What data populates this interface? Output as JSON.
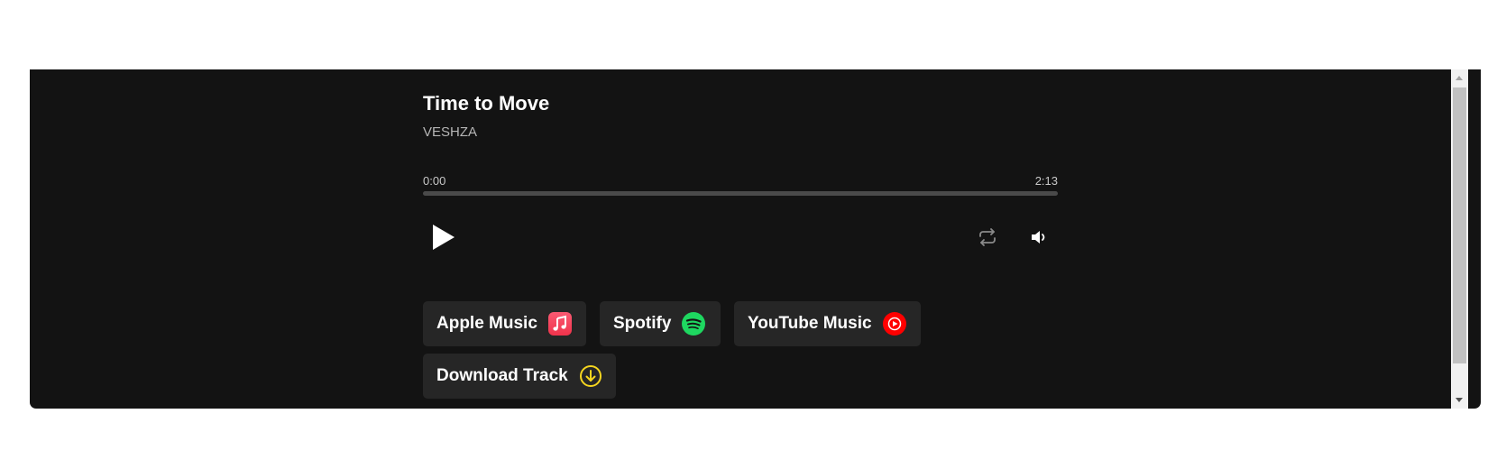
{
  "track": {
    "title": "Time to Move",
    "artist": "VESHZA"
  },
  "playback": {
    "current_time": "0:00",
    "total_time": "2:13",
    "progress_fraction": 0
  },
  "controls": {
    "play_icon": "play-icon",
    "repeat_icon": "repeat-icon",
    "volume_icon": "volume-icon"
  },
  "links": {
    "apple_music": {
      "label": "Apple Music",
      "icon": "apple-music-icon",
      "color": "#f23b55"
    },
    "spotify": {
      "label": "Spotify",
      "icon": "spotify-icon",
      "color": "#1ed760"
    },
    "youtube_music": {
      "label": "YouTube Music",
      "icon": "youtube-music-icon",
      "color": "#ff0000"
    },
    "download": {
      "label": "Download Track",
      "icon": "download-icon",
      "color": "#f5d51f"
    }
  },
  "colors": {
    "background": "#131313",
    "button_bg": "#262626",
    "progress_track": "#4a4a4a"
  }
}
